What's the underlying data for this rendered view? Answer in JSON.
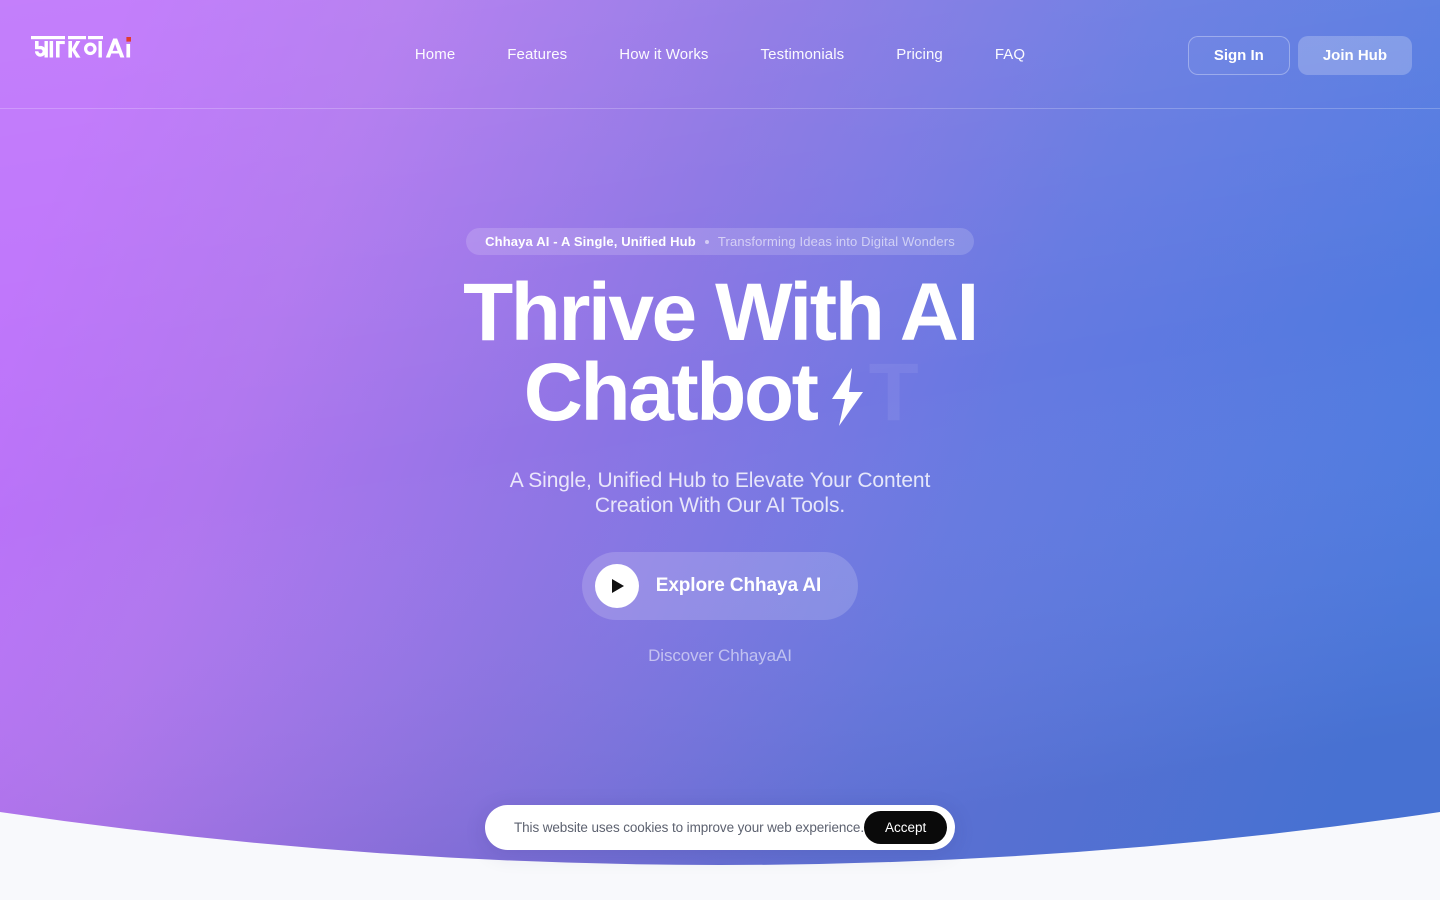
{
  "theme": {
    "gradient_top_left": "#b87cf2",
    "gradient_left_mid": "#bd71fb",
    "gradient_top_right": "#4a7ae0",
    "gradient_bottom_left": "#9566db",
    "gradient_bottom_right": "#4f7ce2",
    "page_background": "#f8f9fc",
    "accent_dot": "#e03b2f",
    "cookie_button": "#0a0a0a"
  },
  "header": {
    "logo": {
      "name": "chhaya-ai-logo",
      "text": "छायाAi",
      "latin_part": "Ai",
      "devanagari_part": "छाया"
    },
    "nav": [
      {
        "label": "Home"
      },
      {
        "label": "Features"
      },
      {
        "label": "How it Works"
      },
      {
        "label": "Testimonials"
      },
      {
        "label": "Pricing"
      },
      {
        "label": "FAQ"
      }
    ],
    "sign_in_label": "Sign In",
    "join_hub_label": "Join Hub"
  },
  "hero": {
    "badge": {
      "strong": "Chhaya AI - A Single, Unified Hub",
      "separator": "•",
      "light": "Transforming Ideas into Digital Wonders"
    },
    "headline_line1": "Thrive With AI",
    "headline_line2": "Chatbot",
    "headline_bolt_icon": "lightning-bolt-icon",
    "headline_ghost": "T",
    "subtitle_line1": "A Single, Unified Hub to Elevate Your Content",
    "subtitle_line2": "Creation With Our AI Tools.",
    "cta_label": "Explore Chhaya AI",
    "cta_icon": "play-icon",
    "discover_label": "Discover ChhayaAI"
  },
  "cookie_banner": {
    "message": "This website uses cookies to improve your web experience.",
    "accept_label": "Accept"
  }
}
